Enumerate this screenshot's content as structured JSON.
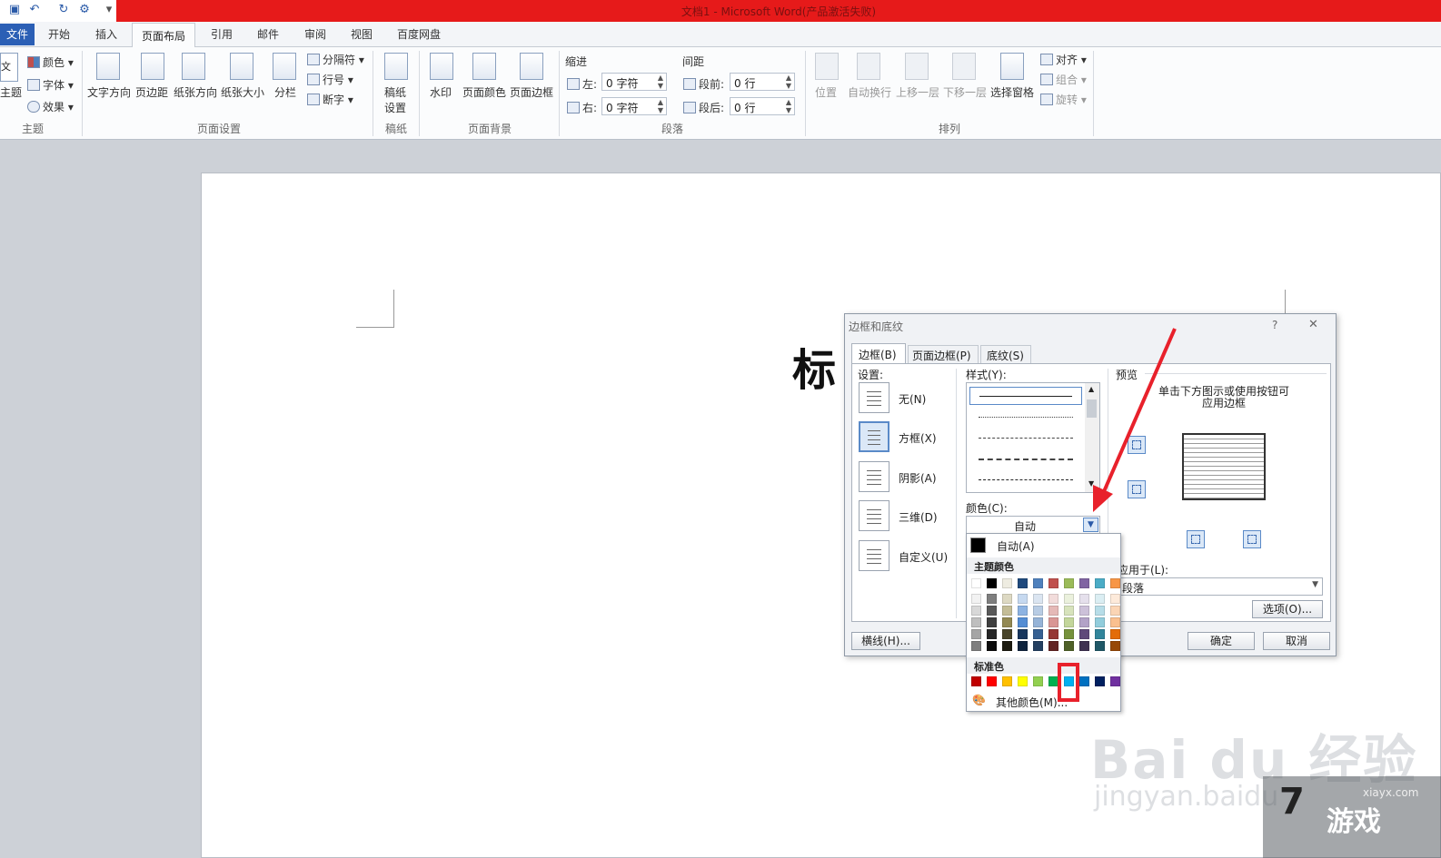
{
  "window": {
    "title": "文档1 - Microsoft Word(产品激活失败)"
  },
  "tabs": {
    "file": "文件",
    "home": "开始",
    "insert": "插入",
    "page_layout": "页面布局",
    "references": "引用",
    "mailings": "邮件",
    "review": "审阅",
    "view": "视图",
    "baidu_disk": "百度网盘"
  },
  "ribbon": {
    "theme": {
      "label_a": "文",
      "theme": "主题",
      "colors": "颜色",
      "fonts": "字体",
      "effects": "效果",
      "group": "主题"
    },
    "page_setup": {
      "text_direction": "文字方向",
      "margins": "页边距",
      "orientation": "纸张方向",
      "size": "纸张大小",
      "columns": "分栏",
      "breaks": "分隔符",
      "line_numbers": "行号",
      "hyphenation": "断字",
      "group": "页面设置"
    },
    "manuscript": {
      "label1": "稿纸",
      "label2": "设置",
      "group": "稿纸"
    },
    "background": {
      "watermark": "水印",
      "page_color": "页面颜色",
      "page_borders": "页面边框",
      "group": "页面背景"
    },
    "paragraph": {
      "indent": "缩进",
      "left": "左:",
      "right": "右:",
      "left_val": "0 字符",
      "right_val": "0 字符",
      "spacing": "间距",
      "before": "段前:",
      "after": "段后:",
      "before_val": "0 行",
      "after_val": "0 行",
      "group": "段落"
    },
    "arrange": {
      "position": "位置",
      "wrap": "自动换行",
      "forward": "上移一层",
      "backward": "下移一层",
      "selection_pane": "选择窗格",
      "align": "对齐",
      "group_btn": "组合",
      "rotate": "旋转",
      "group": "排列"
    }
  },
  "document": {
    "title_text": "标"
  },
  "dialog": {
    "title": "边框和底纹",
    "help": "?",
    "close": "✕",
    "tabs": [
      "边框(B)",
      "页面边框(P)",
      "底纹(S)"
    ],
    "settings_label": "设置:",
    "settings": [
      "无(N)",
      "方框(X)",
      "阴影(A)",
      "三维(D)",
      "自定义(U)"
    ],
    "style_label": "样式(Y):",
    "color_label": "颜色(C):",
    "color_value": "自动",
    "preview_label": "预览",
    "preview_hint_1": "单击下方图示或使用按钮可",
    "preview_hint_2": "应用边框",
    "apply_label": "应用于(L):",
    "apply_value": "段落",
    "options": "选项(O)...",
    "hline": "横线(H)...",
    "ok": "确定",
    "cancel": "取消"
  },
  "palette": {
    "auto": "自动(A)",
    "theme_title": "主题颜色",
    "standard_title": "标准色",
    "more": "其他颜色(M)...",
    "theme_top": [
      "#ffffff",
      "#000000",
      "#eeece1",
      "#1f497d",
      "#4f81bd",
      "#c0504d",
      "#9bbb59",
      "#8064a2",
      "#4bacc6",
      "#f79646"
    ],
    "theme_shades": [
      [
        "#f2f2f2",
        "#d8d8d8",
        "#bfbfbf",
        "#a5a5a5",
        "#7f7f7f"
      ],
      [
        "#7f7f7f",
        "#595959",
        "#3f3f3f",
        "#262626",
        "#0c0c0c"
      ],
      [
        "#ddd9c3",
        "#c4bd97",
        "#938953",
        "#494429",
        "#1d1b10"
      ],
      [
        "#c6d9f0",
        "#8db3e2",
        "#548dd4",
        "#17365d",
        "#0f243e"
      ],
      [
        "#dbe5f1",
        "#b8cce4",
        "#95b3d7",
        "#366092",
        "#244061"
      ],
      [
        "#f2dcdb",
        "#e5b9b7",
        "#d99694",
        "#953734",
        "#632423"
      ],
      [
        "#ebf1dd",
        "#d7e3bc",
        "#c3d69b",
        "#76923c",
        "#4f6128"
      ],
      [
        "#e5e0ec",
        "#ccc1d9",
        "#b2a2c7",
        "#5f497a",
        "#3f3151"
      ],
      [
        "#dbeef3",
        "#b7dde8",
        "#92cddc",
        "#31859b",
        "#205867"
      ],
      [
        "#fdeada",
        "#fbd5b5",
        "#fac08f",
        "#e36c09",
        "#974806"
      ]
    ],
    "standard": [
      "#c00000",
      "#ff0000",
      "#ffc000",
      "#ffff00",
      "#92d050",
      "#00b050",
      "#00b0f0",
      "#0070c0",
      "#002060",
      "#7030a0"
    ]
  },
  "watermark": {
    "baidu": "Bai du 经验",
    "jingyan": "jingyan.baidu",
    "site": "xiayx.com",
    "game": "游戏",
    "seven": "7"
  }
}
